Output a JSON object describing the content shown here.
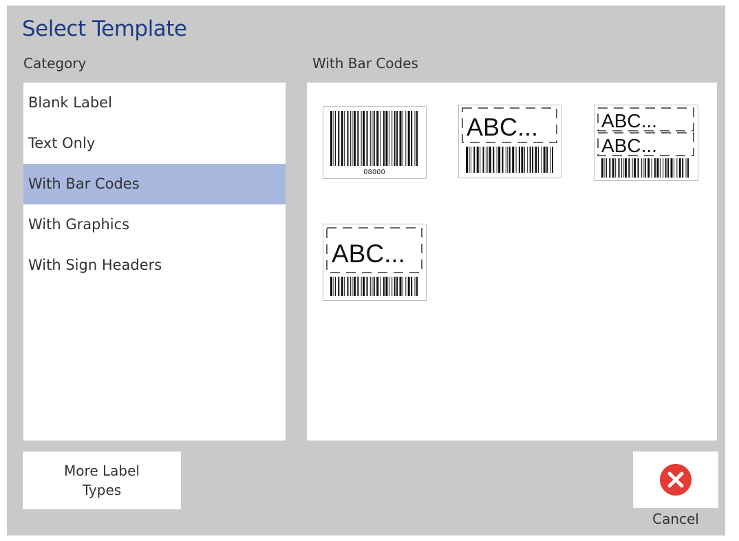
{
  "dialog": {
    "title": "Select Template",
    "category_heading": "Category",
    "templates_heading": "With Bar Codes"
  },
  "categories": [
    {
      "label": "Blank Label",
      "selected": false
    },
    {
      "label": "Text Only",
      "selected": false
    },
    {
      "label": "With Bar Codes",
      "selected": true
    },
    {
      "label": "With Graphics",
      "selected": false
    },
    {
      "label": "With Sign Headers",
      "selected": false
    }
  ],
  "templates": [
    {
      "name": "barcode-only",
      "caption": "08000"
    },
    {
      "name": "text-and-barcode",
      "text": "ABC..."
    },
    {
      "name": "two-text-and-barcode",
      "text": "ABC..."
    },
    {
      "name": "text-and-barcode-tall",
      "text": "ABC..."
    }
  ],
  "buttons": {
    "more_label_types": "More Label Types",
    "cancel": "Cancel"
  },
  "colors": {
    "title": "#1c3b86",
    "selected_row": "#a9b8de",
    "cancel_icon": "#e63a35",
    "dialog_bg": "#c9c9c9"
  },
  "icons": {
    "cancel": "close-circle-icon"
  }
}
